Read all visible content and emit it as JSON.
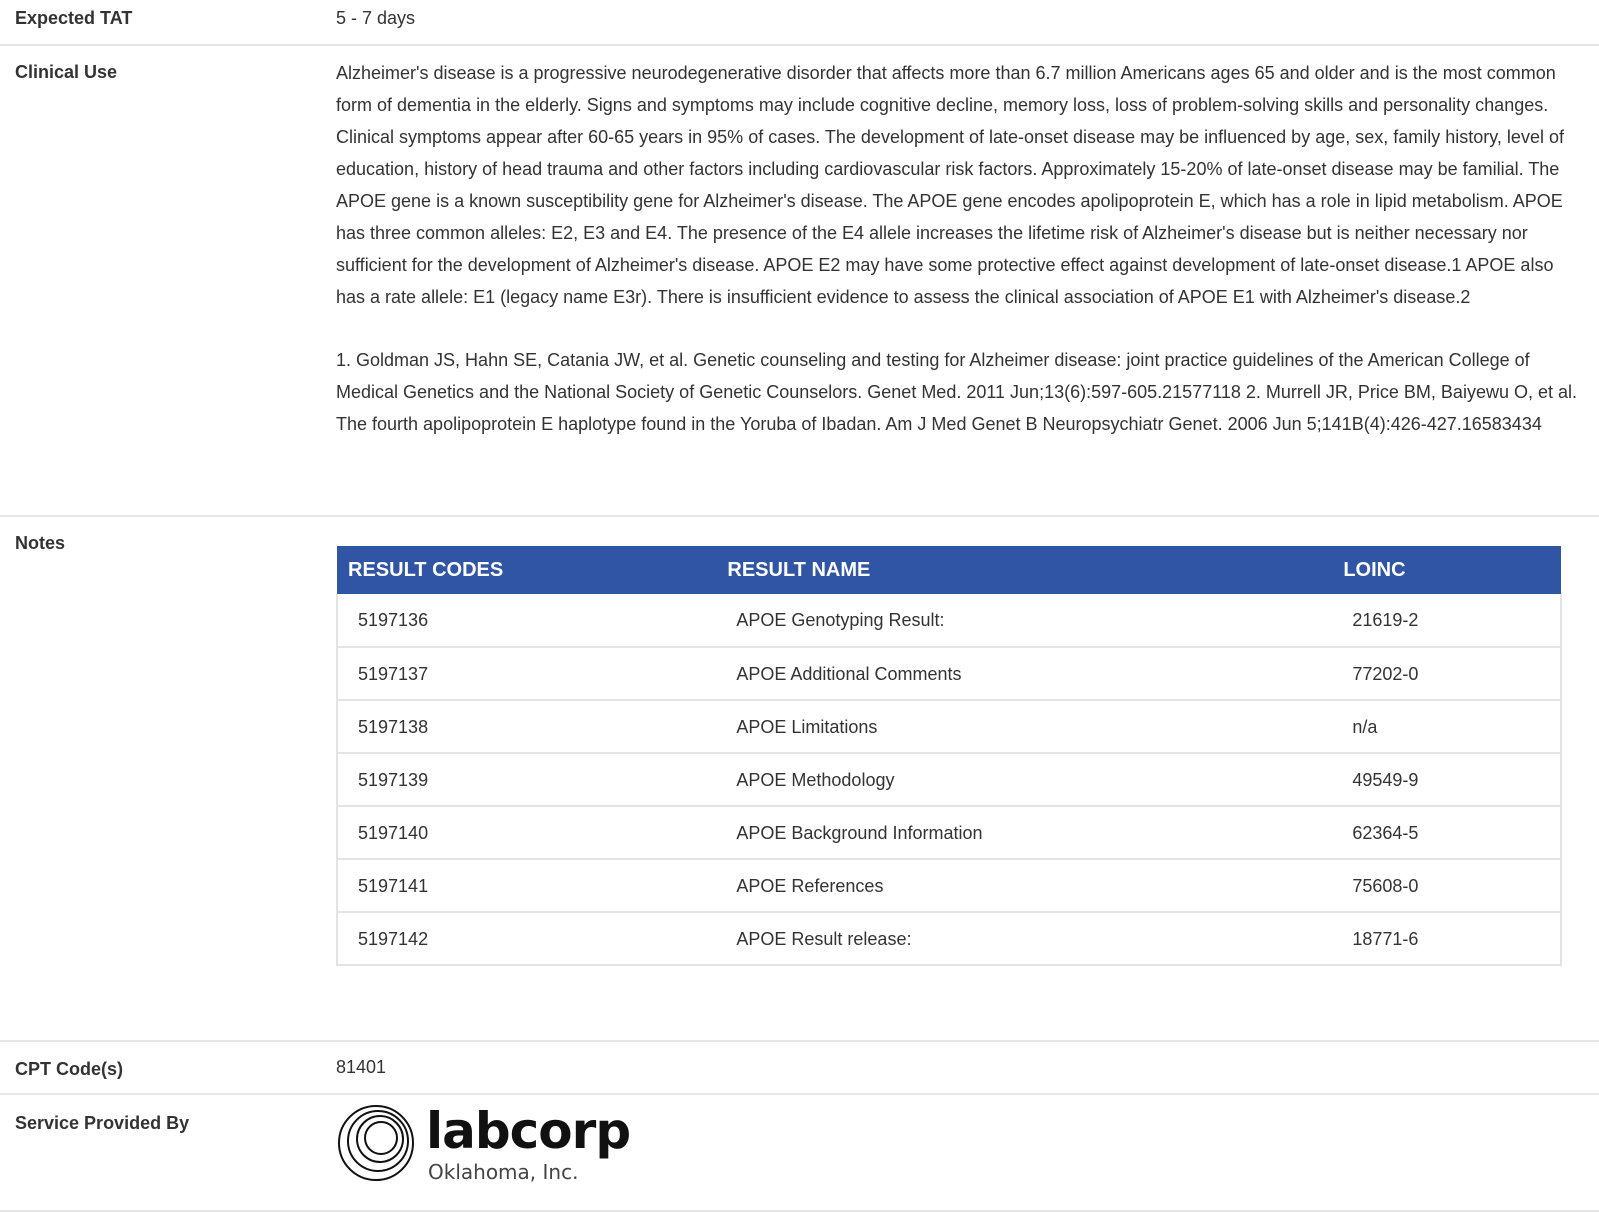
{
  "expected_tat": {
    "label": "Expected TAT",
    "value": "5 - 7 days"
  },
  "clinical_use": {
    "label": "Clinical Use",
    "paragraph1": "Alzheimer's disease is a progressive neurodegenerative disorder that affects more than 6.7 million Americans ages 65 and older and is the most common form of dementia in the elderly. Signs and symptoms may include cognitive decline, memory loss, loss of problem-solving skills and personality changes. Clinical symptoms appear after 60-65 years in 95% of cases. The development of late-onset disease may be influenced by age, sex, family history, level of education, history of head trauma and other factors including cardiovascular risk factors. Approximately 15-20% of late-onset disease may be familial. The APOE gene is a known susceptibility gene for Alzheimer's disease. The APOE gene encodes apolipoprotein E, which has a role in lipid metabolism. APOE has three common alleles: E2, E3 and E4. The presence of the E4 allele increases the lifetime risk of Alzheimer's disease but is neither necessary nor sufficient for the development of Alzheimer's disease. APOE E2 may have some protective effect against development of late-onset disease.1 APOE also has a rate allele: E1 (legacy name E3r). There is insufficient evidence to assess the clinical association of APOE E1 with Alzheimer's disease.2",
    "paragraph2": "1. Goldman JS, Hahn SE, Catania JW, et al. Genetic counseling and testing for Alzheimer disease: joint practice guidelines of the American College of Medical Genetics and the National Society of Genetic Counselors. Genet Med. 2011 Jun;13(6):597-605.21577118 2. Murrell JR, Price BM, Baiyewu O, et al. The fourth apolipoprotein E haplotype found in the Yoruba of Ibadan. Am J Med Genet B Neuropsychiatr Genet. 2006 Jun 5;141B(4):426-427.16583434"
  },
  "notes": {
    "label": "Notes",
    "table": {
      "headers": [
        "RESULT CODES",
        "RESULT NAME",
        "LOINC"
      ],
      "rows": [
        [
          "5197136",
          "APOE Genotyping Result:",
          "21619-2"
        ],
        [
          "5197137",
          "APOE Additional Comments",
          "77202-0"
        ],
        [
          "5197138",
          "APOE Limitations",
          "n/a"
        ],
        [
          "5197139",
          "APOE Methodology",
          "49549-9"
        ],
        [
          "5197140",
          "APOE Background Information",
          "62364-5"
        ],
        [
          "5197141",
          "APOE References",
          "75608-0"
        ],
        [
          "5197142",
          "APOE Result release:",
          "18771-6"
        ]
      ]
    }
  },
  "cpt": {
    "label": "CPT Code(s)",
    "value": "81401"
  },
  "provider": {
    "label": "Service Provided By",
    "logo_word": "labcorp",
    "logo_sub": "Oklahoma, Inc."
  },
  "colors": {
    "table_header_bg": "#3055a4",
    "table_header_text": "#ffffff",
    "row_divider": "#e6e6e6"
  }
}
